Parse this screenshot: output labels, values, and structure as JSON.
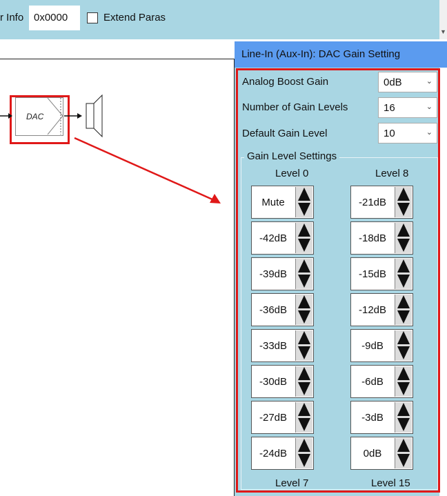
{
  "toolbar": {
    "info_label": "r Info",
    "info_value": "0x0000",
    "extend_label": "Extend Paras"
  },
  "canvas": {
    "dac_label": "DAC"
  },
  "dialog": {
    "title": "Line-In (Aux-In): DAC Gain Setting",
    "analog_boost_label": "Analog Boost Gain",
    "analog_boost_value": "0dB",
    "num_levels_label": "Number of Gain Levels",
    "num_levels_value": "16",
    "default_level_label": "Default Gain Level",
    "default_level_value": "10",
    "group_title": "Gain Level Settings",
    "col_left_top": "Level 0",
    "col_left_bottom": "Level 7",
    "col_right_top": "Level 8",
    "col_right_bottom": "Level 15",
    "left_levels": [
      "Mute",
      "-42dB",
      "-39dB",
      "-36dB",
      "-33dB",
      "-30dB",
      "-27dB",
      "-24dB"
    ],
    "right_levels": [
      "-21dB",
      "-18dB",
      "-15dB",
      "-12dB",
      "-9dB",
      "-6dB",
      "-3dB",
      "0dB"
    ]
  },
  "colors": {
    "panel_bg": "#a9d6e3",
    "title_bar": "#5b9bef",
    "highlight_red": "#e01818"
  }
}
